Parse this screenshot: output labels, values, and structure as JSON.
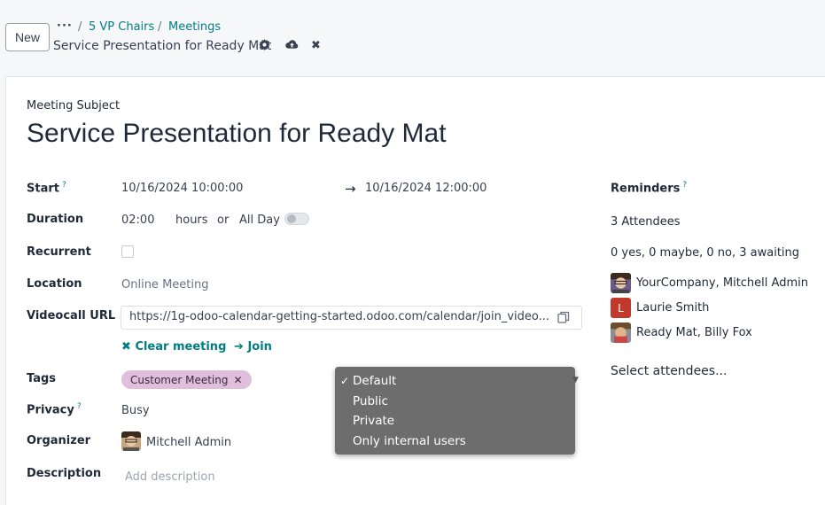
{
  "control_panel": {
    "new_label": "New",
    "breadcrumb_dots": "···",
    "breadcrumb_sep": "/",
    "breadcrumb_items": [
      "5 VP Chairs",
      "Meetings"
    ],
    "record_name": "Service Presentation for Ready Mat",
    "icons": [
      "gear-icon",
      "cloud-upload-icon",
      "discard-icon"
    ]
  },
  "form": {
    "subject_label": "Meeting Subject",
    "subject": "Service Presentation for Ready Mat",
    "start": {
      "label": "Start",
      "help": "?",
      "from": "10/16/2024 10:00:00",
      "arrow": "→",
      "to": "10/16/2024 12:00:00"
    },
    "duration": {
      "label": "Duration",
      "value": "02:00",
      "unit": "hours",
      "or": "or",
      "all_day": "All Day",
      "all_day_on": false
    },
    "recurrent": {
      "label": "Recurrent",
      "checked": false
    },
    "location": {
      "label": "Location",
      "value": "Online Meeting"
    },
    "videocall": {
      "label": "Videocall URL",
      "value": "https://1g-odoo-calendar-getting-started.odoo.com/calendar/join_video...",
      "clear": "Clear meeting",
      "join": "Join"
    },
    "tags": {
      "label": "Tags",
      "items": [
        {
          "label": "Customer Meeting",
          "color": "#dfbfdc"
        }
      ]
    },
    "privacy": {
      "label": "Privacy",
      "help": "?",
      "value": "Busy"
    },
    "organizer": {
      "label": "Organizer",
      "value": "Mitchell Admin"
    },
    "description": {
      "label": "Description",
      "placeholder": "Add description"
    }
  },
  "privacy_dropdown": {
    "options": [
      "Default",
      "Public",
      "Private",
      "Only internal users"
    ],
    "selected": "Default",
    "check": "✓"
  },
  "right_panel": {
    "reminders_label": "Reminders",
    "reminders_help": "?",
    "attendee_count": "3 Attendees",
    "attendee_status": "0 yes, 0 maybe, 0 no, 3 awaiting",
    "attendees": [
      {
        "name": "YourCompany, Mitchell Admin",
        "avatar": "person-photo"
      },
      {
        "name": "Laurie Smith",
        "avatar_letter": "L",
        "color": "#c0392b"
      },
      {
        "name": "Ready Mat, Billy Fox",
        "avatar": "person-photo"
      }
    ],
    "select_placeholder": "Select attendees..."
  },
  "colors": {
    "link": "#017e84",
    "tag": "#dfbfdc",
    "dropdown_bg": "#6d6d6d"
  }
}
